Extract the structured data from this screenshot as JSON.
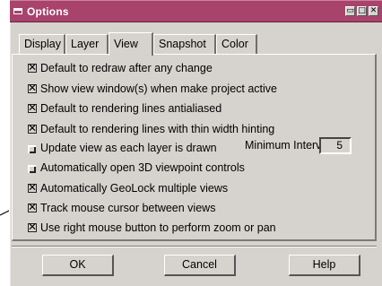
{
  "window": {
    "title": "Options",
    "controls": {
      "minimize": "▭",
      "maximize": "□",
      "close": "✕"
    }
  },
  "tabs": [
    {
      "label": "Display",
      "active": false
    },
    {
      "label": "Layer",
      "active": false
    },
    {
      "label": "View",
      "active": true
    },
    {
      "label": "Snapshot",
      "active": false
    },
    {
      "label": "Color",
      "active": false
    }
  ],
  "options": [
    {
      "label": "Default to redraw after any change",
      "checked": true
    },
    {
      "label": "Show view window(s) when make project active",
      "checked": true
    },
    {
      "label": "Default to rendering lines antialiased",
      "checked": true
    },
    {
      "label": "Default to rendering lines with thin width hinting",
      "checked": true
    },
    {
      "label": "Update view as each layer is drawn",
      "checked": false
    },
    {
      "label": "Automatically open 3D viewpoint controls",
      "checked": false
    },
    {
      "label": "Automatically GeoLock multiple views",
      "checked": true
    },
    {
      "label": "Track mouse cursor between views",
      "checked": true
    },
    {
      "label": "Use right mouse button to perform zoom or pan",
      "checked": true
    }
  ],
  "interval": {
    "label": "Minimum Interval",
    "value": "5"
  },
  "buttons": {
    "ok": "OK",
    "cancel": "Cancel",
    "help": "Help"
  },
  "colors": {
    "titlebar": "#a8436b",
    "face": "#d6d3ce"
  },
  "icons": {
    "title": "window-icon",
    "check": "x-check-icon"
  }
}
